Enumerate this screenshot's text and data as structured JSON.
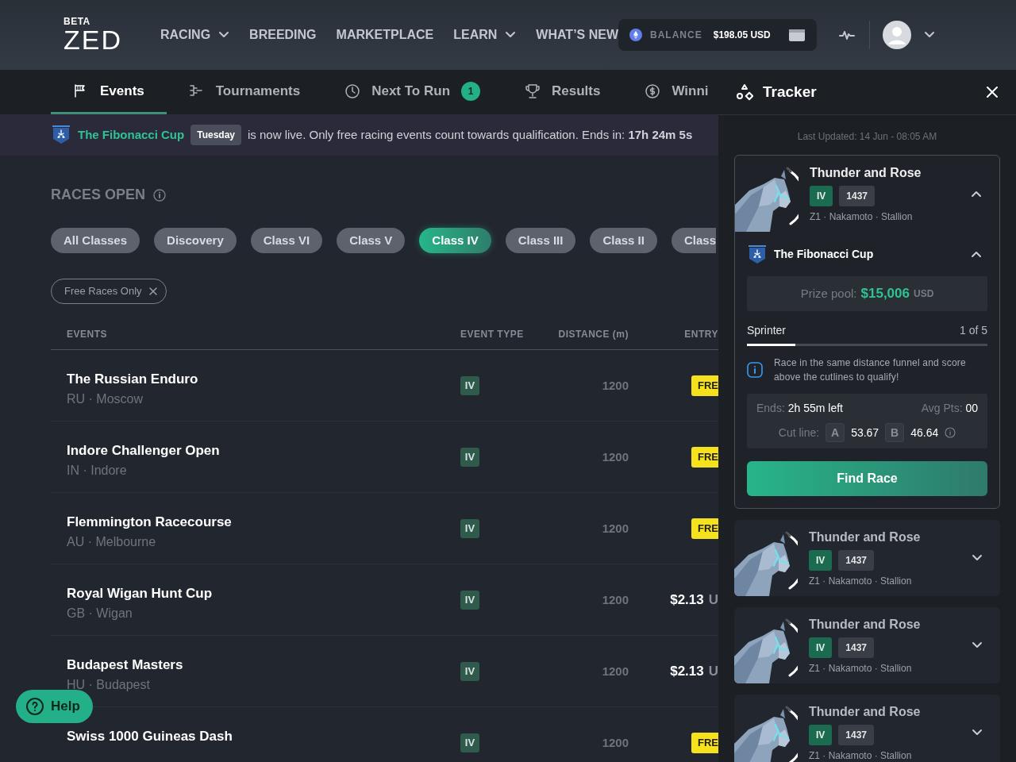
{
  "header": {
    "logo": {
      "badge": "BETA",
      "text": "ZED"
    },
    "nav": [
      {
        "label": "RACING",
        "dropdown": true
      },
      {
        "label": "BREEDING",
        "dropdown": false
      },
      {
        "label": "MARKETPLACE",
        "dropdown": false
      },
      {
        "label": "LEARN",
        "dropdown": true
      },
      {
        "label": "WHAT’S NEW",
        "dropdown": false
      }
    ],
    "balance": {
      "label": "BALANCE",
      "amount": "$198.05 USD"
    }
  },
  "tabs": [
    {
      "label": "Events",
      "selected": true
    },
    {
      "label": "Tournaments",
      "selected": false
    },
    {
      "label": "Next To Run",
      "selected": false,
      "count": "1"
    },
    {
      "label": "Results",
      "selected": false
    },
    {
      "label": "Winni",
      "selected": false
    }
  ],
  "banner": {
    "cup": "The Fibonacci Cup",
    "day": "Tuesday",
    "message": "is now live. Only free racing events count towards qualification. Ends in: **17h 24m 5s**"
  },
  "races": {
    "title": "RACES OPEN",
    "classes": [
      {
        "label": "All Classes",
        "selected": false
      },
      {
        "label": "Discovery",
        "selected": false
      },
      {
        "label": "Class VI",
        "selected": false
      },
      {
        "label": "Class V",
        "selected": false
      },
      {
        "label": "Class IV",
        "selected": true
      },
      {
        "label": "Class III",
        "selected": false
      },
      {
        "label": "Class II",
        "selected": false
      },
      {
        "label": "Class",
        "selected": false
      }
    ],
    "filter": "Free Races Only",
    "table": {
      "columns": [
        "EVENTS",
        "EVENT TYPE",
        "DISTANCE (m)",
        "ENTRY"
      ],
      "rows": [
        {
          "name": "The Russian Enduro",
          "location": "RU · Moscow",
          "event_type": "IV",
          "distance": "1200",
          "entry": {
            "kind": "free",
            "text": "FRE"
          }
        },
        {
          "name": "Indore Challenger Open",
          "location": "IN · Indore",
          "event_type": "IV",
          "distance": "1200",
          "entry": {
            "kind": "free",
            "text": "FRE"
          }
        },
        {
          "name": "Flemmington Racecourse",
          "location": "AU · Melbourne",
          "event_type": "IV",
          "distance": "1200",
          "entry": {
            "kind": "free",
            "text": "FRE"
          }
        },
        {
          "name": "Royal Wigan Hunt Cup",
          "location": "GB · Wigan",
          "event_type": "IV",
          "distance": "1200",
          "entry": {
            "kind": "price",
            "text": "$2.13",
            "unit": "U"
          }
        },
        {
          "name": "Budapest Masters",
          "location": "HU · Budapest",
          "event_type": "IV",
          "distance": "1200",
          "entry": {
            "kind": "price",
            "text": "$2.13",
            "unit": "U"
          }
        },
        {
          "name": "Swiss 1000 Guineas Dash",
          "location": "",
          "event_type": "IV",
          "distance": "1200",
          "entry": {
            "kind": "free",
            "text": "FRE"
          }
        }
      ]
    }
  },
  "help": "Help",
  "tracker": {
    "title": "Tracker",
    "last_updated": "Last Updated: 14 Jun - 08:05 AM",
    "horses": [
      {
        "name": "Thunder and Rose",
        "class": "IV",
        "rating": "1437",
        "details": "Z1 · Nakamoto · Stallion",
        "expanded": true,
        "tournament": {
          "name": "The Fibonacci Cup",
          "prize_label": "Prize pool:",
          "prize": "$15,006",
          "currency": "USD",
          "funnel": "Sprinter",
          "progress": "1 of 5",
          "level": 0.2,
          "info": "Race in the same distance funnel and score above the cutlines to qualify!",
          "ends_label": "Ends:",
          "ends": "2h 55m left",
          "avg_label": "Avg Pts:",
          "avg": "00",
          "cut_label": "Cut line:",
          "cuts": [
            {
              "grade": "A",
              "value": "53.67"
            },
            {
              "grade": "B",
              "value": "46.64"
            }
          ],
          "button": "Find Race"
        }
      },
      {
        "name": "Thunder and Rose",
        "class": "IV",
        "rating": "1437",
        "details": "Z1 · Nakamoto · Stallion",
        "expanded": false
      },
      {
        "name": "Thunder and Rose",
        "class": "IV",
        "rating": "1437",
        "details": "Z1 · Nakamoto · Stallion",
        "expanded": false
      },
      {
        "name": "Thunder and Rose",
        "class": "IV",
        "rating": "1437",
        "details": "Z1 · Nakamoto · Stallion",
        "expanded": false
      }
    ]
  }
}
